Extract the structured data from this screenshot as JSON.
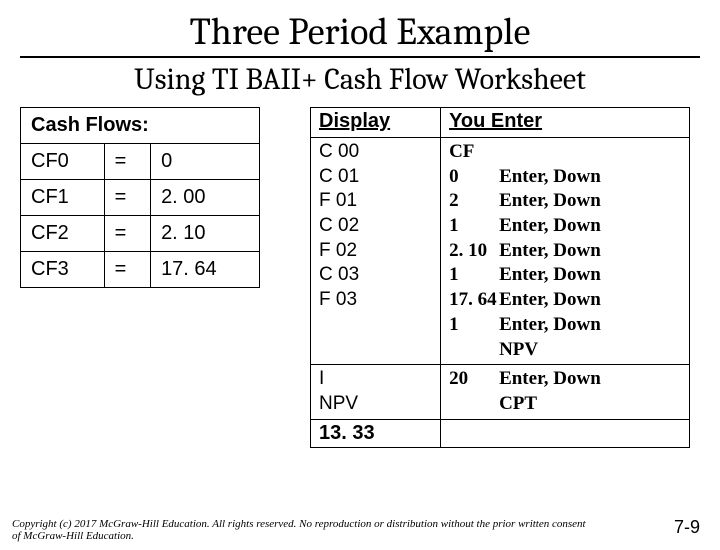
{
  "title": "Three Period Example",
  "subtitle": "Using TI BAII+ Cash Flow Worksheet",
  "cash_flows_header": "Cash Flows:",
  "cf_rows": [
    {
      "label": "CF0",
      "eq": "=",
      "val": "0"
    },
    {
      "label": "CF1",
      "eq": "=",
      "val": "2. 00"
    },
    {
      "label": "CF2",
      "eq": "=",
      "val": "2. 10"
    },
    {
      "label": "CF3",
      "eq": "=",
      "val": "17. 64"
    }
  ],
  "calc": {
    "display_head": "Display",
    "enter_head": "You Enter",
    "cf_line": "CF",
    "disp_lines": [
      "C 00",
      "C 01",
      "F 01",
      "C 02",
      "F 02",
      "C 03",
      "F 03"
    ],
    "enter_rows": [
      {
        "v": "0",
        "a": "Enter, Down"
      },
      {
        "v": "2",
        "a": "Enter, Down"
      },
      {
        "v": "1",
        "a": "Enter, Down"
      },
      {
        "v": "2. 10",
        "a": "Enter, Down"
      },
      {
        "v": "1",
        "a": "Enter, Down"
      },
      {
        "v": "17. 64",
        "a": "Enter, Down"
      },
      {
        "v": "1",
        "a": "Enter, Down"
      },
      {
        "v": "",
        "a": "NPV"
      }
    ],
    "disp2": [
      "I",
      "NPV"
    ],
    "enter2": [
      {
        "v": "20",
        "a": "Enter, Down"
      },
      {
        "v": "",
        "a": "CPT"
      }
    ],
    "result": "13. 33"
  },
  "copyright": "Copyright (c) 2017 McGraw-Hill Education. All rights reserved. No reproduction or distribution without the prior written consent of McGraw-Hill Education.",
  "page": "7-9"
}
